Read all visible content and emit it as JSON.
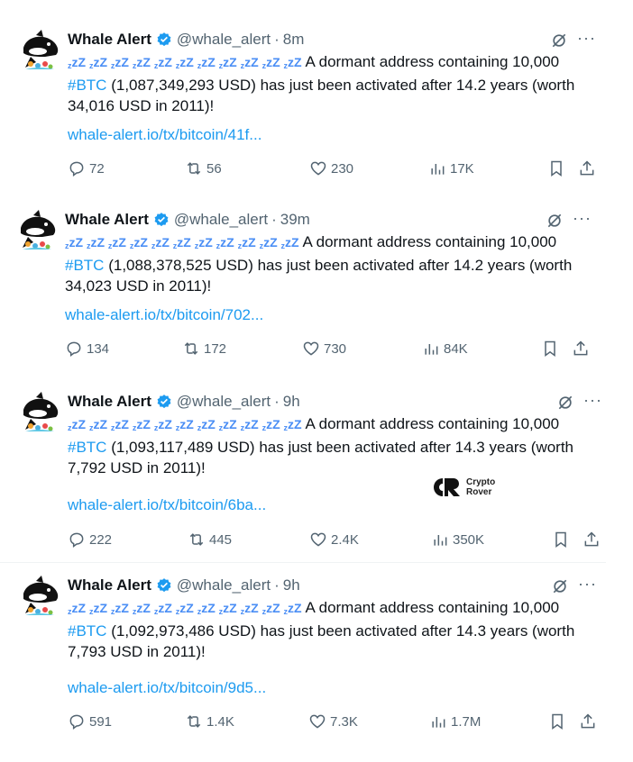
{
  "tweets": [
    {
      "name": "Whale Alert",
      "handle": "@whale_alert",
      "separator": "·",
      "time": "8m",
      "more": "···",
      "text_before_tag": "A dormant address containing 10,000",
      "hashtag": "#BTC",
      "text_after_tag": "(1,087,349,293 USD) has just been activated after 14.2 years (worth 34,016 USD in 2011)!",
      "link": "whale-alert.io/tx/bitcoin/41f...",
      "replies": "72",
      "reposts": "56",
      "likes": "230",
      "views": "17K"
    },
    {
      "name": "Whale Alert",
      "handle": "@whale_alert",
      "separator": "·",
      "time": "39m",
      "more": "···",
      "text_before_tag": "A dormant address containing 10,000",
      "hashtag": "#BTC",
      "text_after_tag": "(1,088,378,525 USD) has just been activated after 14.2 years (worth 34,023 USD in 2011)!",
      "link": "whale-alert.io/tx/bitcoin/702...",
      "replies": "134",
      "reposts": "172",
      "likes": "730",
      "views": "84K"
    },
    {
      "name": "Whale Alert",
      "handle": "@whale_alert",
      "separator": "·",
      "time": "9h",
      "more": "···",
      "text_before_tag": "A dormant address containing 10,000",
      "hashtag": "#BTC",
      "text_after_tag": "(1,093,117,489 USD) has just been activated after 14.3 years (worth 7,792 USD in 2011)!",
      "link": "whale-alert.io/tx/bitcoin/6ba...",
      "replies": "222",
      "reposts": "445",
      "likes": "2.4K",
      "views": "350K"
    },
    {
      "name": "Whale Alert",
      "handle": "@whale_alert",
      "separator": "·",
      "time": "9h",
      "more": "···",
      "text_before_tag": "A dormant address containing 10,000",
      "hashtag": "#BTC",
      "text_after_tag": "(1,092,973,486 USD) has just been activated after 14.3 years (worth 7,793 USD in 2011)!",
      "link": "whale-alert.io/tx/bitcoin/9d5...",
      "replies": "591",
      "reposts": "1.4K",
      "likes": "7.3K",
      "views": "1.7M"
    }
  ],
  "zzz_emoji_count": 11,
  "watermark": {
    "logo_text": "CR",
    "line1": "Crypto",
    "line2": "Rover"
  },
  "colors": {
    "link": "#1d9bf0",
    "muted": "#536471",
    "text": "#0f1419",
    "verified": "#1d9bf0",
    "zzz": "#4a8ef5"
  },
  "icons": {
    "reply": "reply-icon",
    "repost": "repost-icon",
    "like": "heart-icon",
    "views": "views-icon",
    "bookmark": "bookmark-icon",
    "share": "share-icon",
    "grok": "grok-icon",
    "more": "more-icon",
    "verified": "verified-badge-icon"
  }
}
